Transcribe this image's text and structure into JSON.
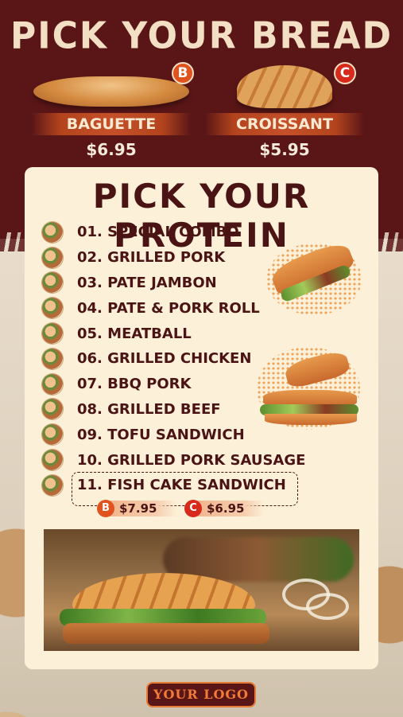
{
  "bread_section": {
    "title": "PICK YOUR BREAD",
    "options": [
      {
        "badge": "B",
        "name": "BAGUETTE",
        "price": "$6.95"
      },
      {
        "badge": "C",
        "name": "CROISSANT",
        "price": "$5.95"
      }
    ]
  },
  "protein_section": {
    "title": "PICK YOUR PROTEIN",
    "items": [
      "01. SPECIAL COMBO",
      "02. GRILLED PORK",
      "03. PATE JAMBON",
      "04. PATE & PORK ROLL",
      "05. MEATBALL",
      "06. GRILLED CHICKEN",
      "07. BBQ PORK",
      "08. GRILLED BEEF",
      "09. TOFU SANDWICH",
      "10. GRILLED PORK SAUSAGE",
      "11. FISH CAKE SANDWICH"
    ],
    "special_prices": [
      {
        "badge": "B",
        "price": "$7.95"
      },
      {
        "badge": "C",
        "price": "$6.95"
      }
    ]
  },
  "logo": {
    "text": "YOUR LOGO"
  },
  "colors": {
    "maroon": "#5a1617",
    "cream": "#fdf0d8",
    "text_dark": "#4a1414",
    "accent_orange": "#e1531e",
    "accent_red": "#d72a1c"
  }
}
